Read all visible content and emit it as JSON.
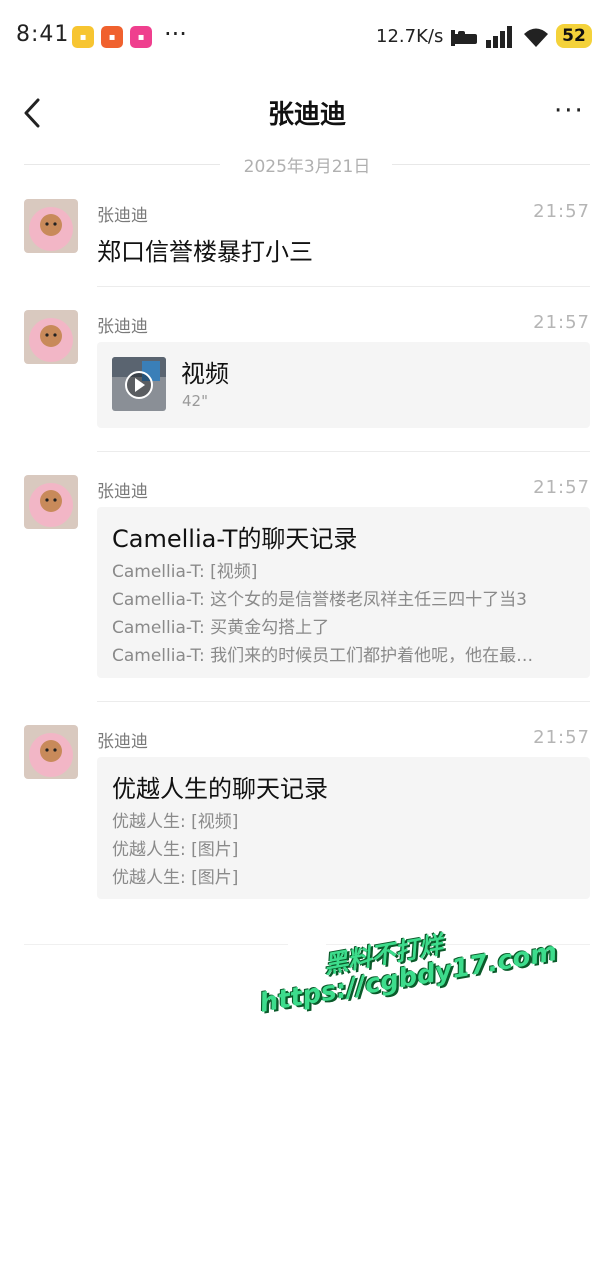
{
  "status_bar": {
    "time": "8:41",
    "more": "···",
    "speed": "12.7K/s",
    "battery": "52",
    "icons": [
      "app-icon-yellow",
      "app-icon-orange",
      "app-icon-pink",
      "bed-icon",
      "signal-icon",
      "wifi-icon"
    ]
  },
  "header": {
    "title": "张迪迪",
    "more": "···"
  },
  "date_divider": "2025年3月21日",
  "messages": [
    {
      "sender": "张迪迪",
      "time": "21:57",
      "text": "郑口信誉楼暴打小三"
    },
    {
      "sender": "张迪迪",
      "time": "21:57",
      "video": {
        "label": "视频",
        "duration": "42\""
      }
    },
    {
      "sender": "张迪迪",
      "time": "21:57",
      "record": {
        "title": "Camellia-T的聊天记录",
        "lines": [
          "Camellia-T: [视频]",
          "Camellia-T: 这个女的是信誉楼老凤祥主任三四十了当3",
          "Camellia-T: 买黄金勾搭上了",
          "Camellia-T: 我们来的时候员工们都护着他呢，他在最…"
        ]
      }
    },
    {
      "sender": "张迪迪",
      "time": "21:57",
      "record": {
        "title": "优越人生的聊天记录",
        "lines": [
          "优越人生: [视频]",
          "优越人生: [图片]",
          "优越人生: [图片]"
        ]
      }
    }
  ],
  "watermark": {
    "line1": "黑料不打烊",
    "line2": "https://cgbdy17.com"
  },
  "colors": {
    "accent_battery": "#f4d23a",
    "watermark": "#3ddc8c",
    "card_bg": "#f5f5f5"
  }
}
